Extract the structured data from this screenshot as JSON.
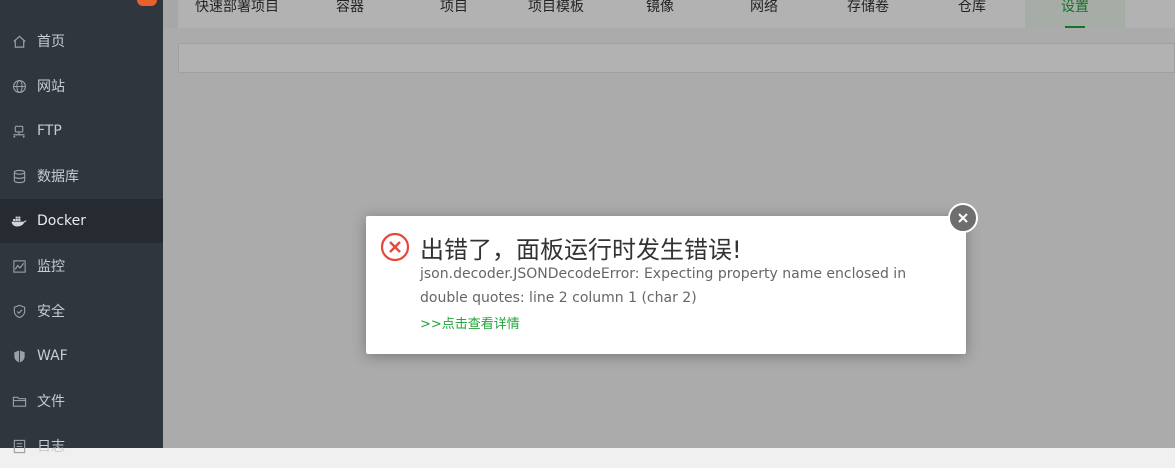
{
  "sidebar": {
    "items": [
      {
        "label": "首页",
        "icon": "home-icon"
      },
      {
        "label": "网站",
        "icon": "globe-icon"
      },
      {
        "label": "FTP",
        "icon": "ftp-icon"
      },
      {
        "label": "数据库",
        "icon": "database-icon"
      },
      {
        "label": "Docker",
        "icon": "docker-icon"
      },
      {
        "label": "监控",
        "icon": "monitor-icon"
      },
      {
        "label": "安全",
        "icon": "shield-icon"
      },
      {
        "label": "WAF",
        "icon": "waf-shield-icon"
      },
      {
        "label": "文件",
        "icon": "folder-icon"
      },
      {
        "label": "日志",
        "icon": "log-icon"
      }
    ],
    "active": "Docker"
  },
  "tabs": [
    {
      "label": "快速部署项目"
    },
    {
      "label": "容器"
    },
    {
      "label": "项目"
    },
    {
      "label": "项目模板"
    },
    {
      "label": "镜像"
    },
    {
      "label": "网络"
    },
    {
      "label": "存储卷"
    },
    {
      "label": "仓库"
    },
    {
      "label": "设置"
    }
  ],
  "dialog": {
    "title": "出错了，面板运行时发生错误!",
    "message": "json.decoder.JSONDecodeError: Expecting property name enclosed in double quotes: line 2 column 1 (char 2)",
    "link": ">>点击查看详情"
  },
  "colors": {
    "sidebar_bg": "#30363e",
    "accent": "#20a53a",
    "error": "#e8473b"
  }
}
